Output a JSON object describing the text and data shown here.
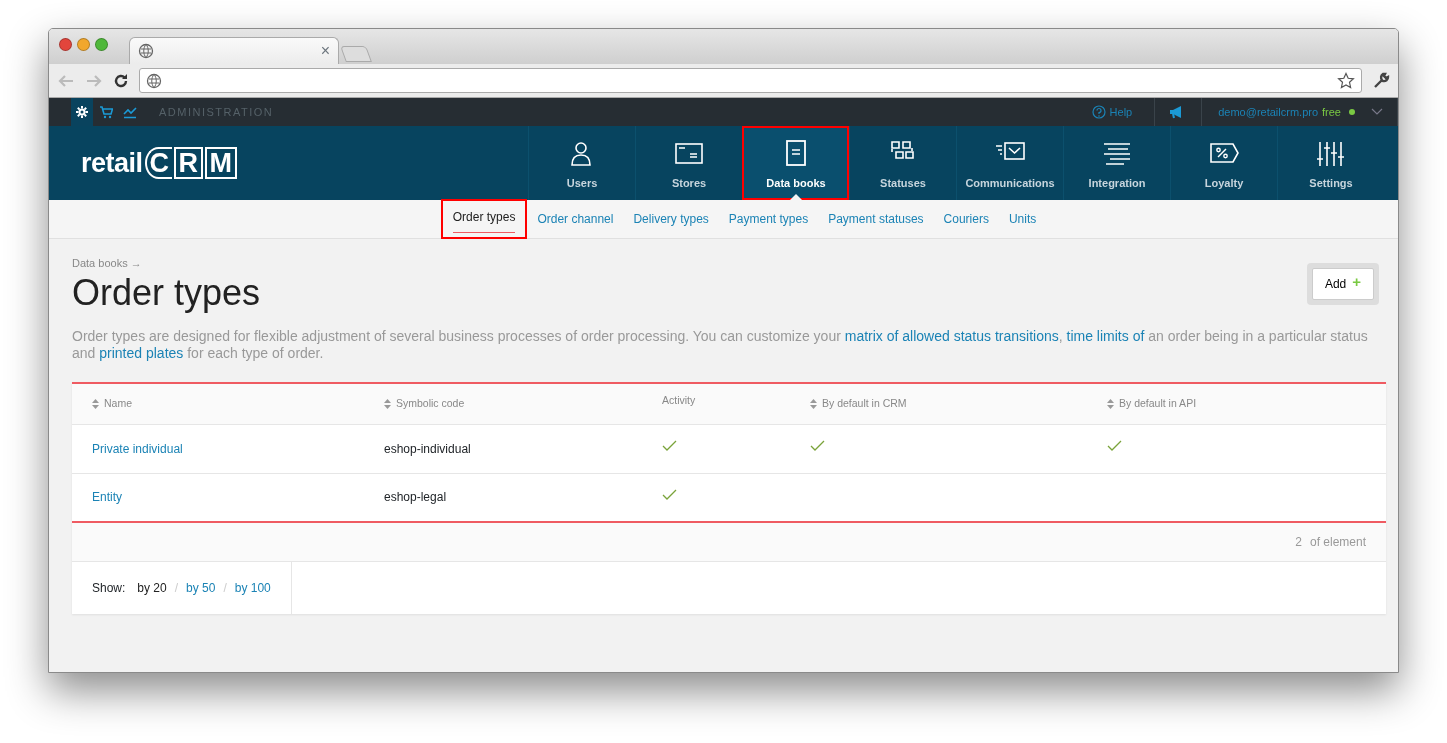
{
  "browser": {
    "tab_close": "×"
  },
  "admin_bar": {
    "sections": [
      {
        "selected": true
      },
      {
        "selected": false
      },
      {
        "selected": false
      }
    ],
    "title": "ADMINISTRATION",
    "help": "Help",
    "user_email": "demo@retailcrm.pro",
    "plan": "free",
    "online": true
  },
  "logo": {
    "prefix": "retail",
    "letters": [
      "C",
      "R",
      "M"
    ]
  },
  "main_nav": [
    {
      "label": "Users",
      "selected": false,
      "highlighted": false
    },
    {
      "label": "Stores",
      "selected": false,
      "highlighted": false
    },
    {
      "label": "Data books",
      "selected": true,
      "highlighted": true
    },
    {
      "label": "Statuses",
      "selected": false,
      "highlighted": false
    },
    {
      "label": "Communications",
      "selected": false,
      "highlighted": false
    },
    {
      "label": "Integration",
      "selected": false,
      "highlighted": false
    },
    {
      "label": "Loyalty",
      "selected": false,
      "highlighted": false
    },
    {
      "label": "Settings",
      "selected": false,
      "highlighted": false
    }
  ],
  "sub_nav": [
    {
      "label": "Order types",
      "selected": true,
      "highlighted": true
    },
    {
      "label": "Order channel",
      "selected": false,
      "highlighted": false
    },
    {
      "label": "Delivery types",
      "selected": false,
      "highlighted": false
    },
    {
      "label": "Payment types",
      "selected": false,
      "highlighted": false
    },
    {
      "label": "Payment statuses",
      "selected": false,
      "highlighted": false
    },
    {
      "label": "Couriers",
      "selected": false,
      "highlighted": false
    },
    {
      "label": "Units",
      "selected": false,
      "highlighted": false
    }
  ],
  "breadcrumb": "Data books →",
  "page_title": "Order types",
  "add_button": {
    "label": "Add",
    "icon": "+"
  },
  "description": [
    {
      "text": "Order types are designed for flexible adjustment of several business processes of order processing. You can customize your ",
      "link": false
    },
    {
      "text": "matrix of allowed status transitions",
      "link": true
    },
    {
      "text": ", ",
      "link": false
    },
    {
      "text": "time limits of",
      "link": true
    },
    {
      "text": " an order being in a particular status and ",
      "link": false
    },
    {
      "text": "printed plates",
      "link": true
    },
    {
      "text": " for each type of order.",
      "link": false
    }
  ],
  "table": {
    "columns": [
      {
        "label": "Name",
        "sortable": true
      },
      {
        "label": "Symbolic code",
        "sortable": true
      },
      {
        "label": "Activity",
        "sortable": false
      },
      {
        "label": "By default in CRM",
        "sortable": true
      },
      {
        "label": "By default in API",
        "sortable": true
      }
    ],
    "rows": [
      {
        "name": "Private individual",
        "code": "eshop-individual",
        "active": true,
        "default_crm": true,
        "default_api": true
      },
      {
        "name": "Entity",
        "code": "eshop-legal",
        "active": true,
        "default_crm": false,
        "default_api": false
      }
    ],
    "count": "2",
    "count_label": "of element"
  },
  "pagination": {
    "label": "Show:",
    "separator": "/",
    "options": [
      {
        "label": "by 20",
        "selected": true
      },
      {
        "label": "by 50",
        "selected": false
      },
      {
        "label": "by 100",
        "selected": false
      }
    ]
  }
}
